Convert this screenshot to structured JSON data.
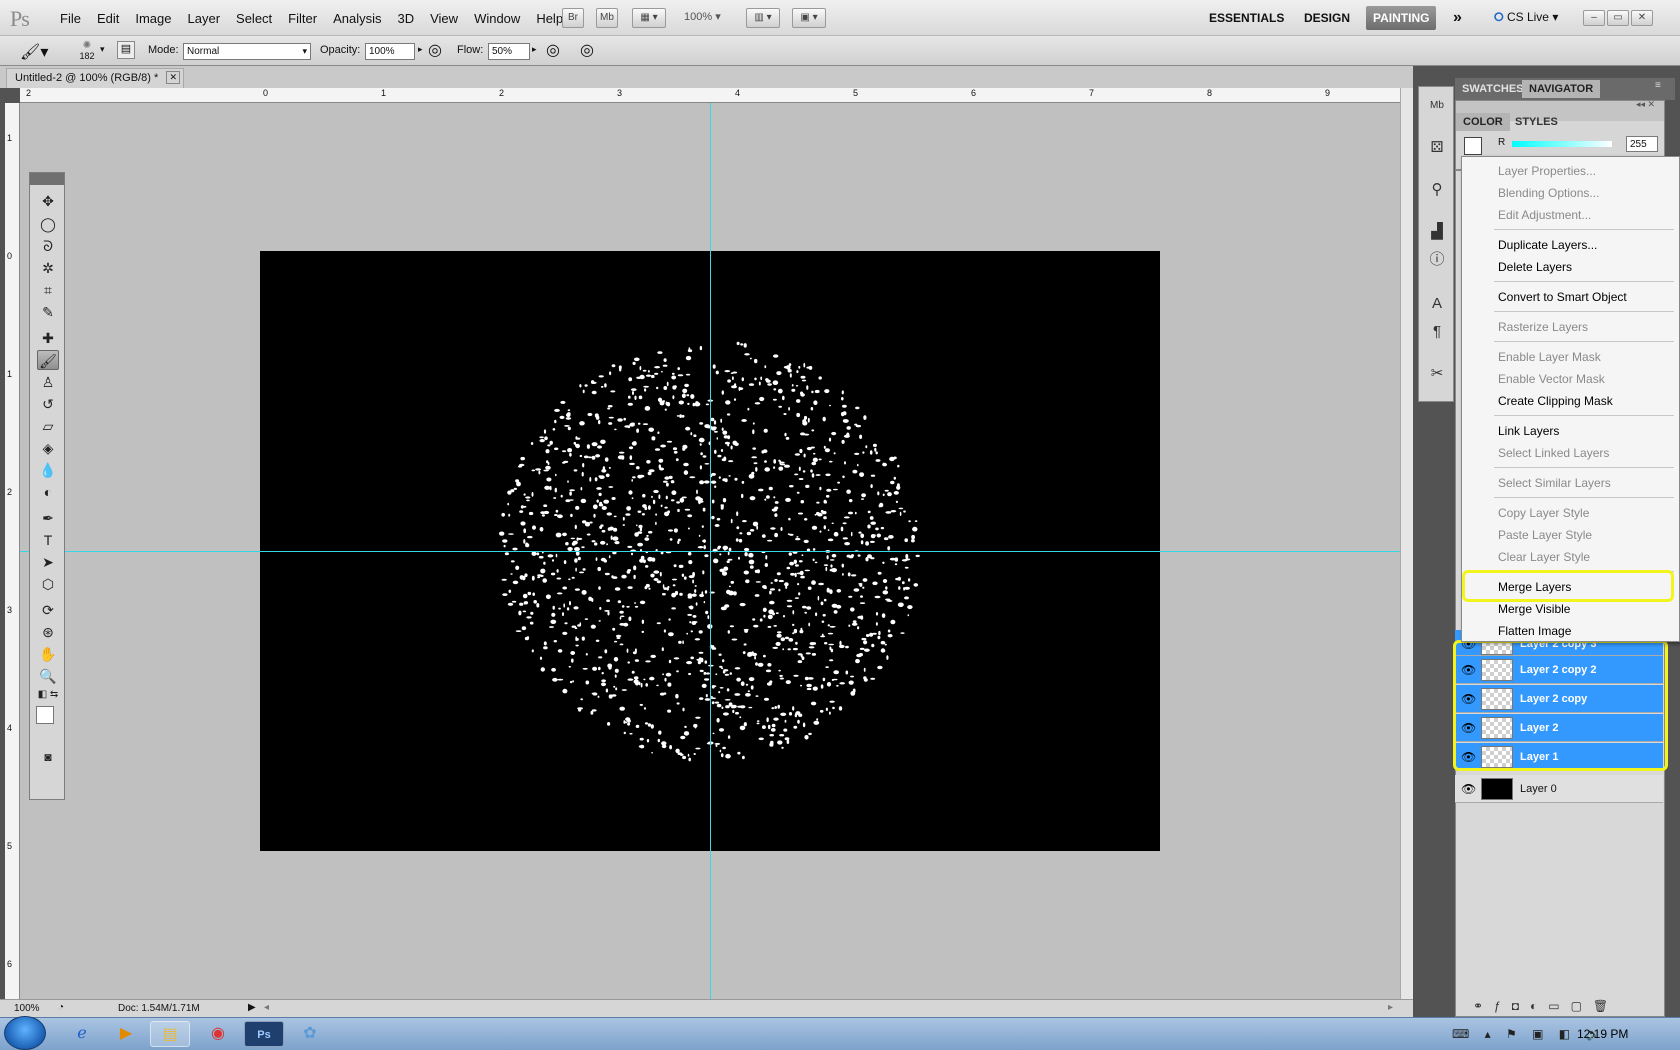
{
  "app": {
    "logo": "Ps"
  },
  "menubar": {
    "items": [
      "File",
      "Edit",
      "Image",
      "Layer",
      "Select",
      "Filter",
      "Analysis",
      "3D",
      "View",
      "Window",
      "Help"
    ],
    "br": "Br",
    "mb": "Mb",
    "zoom": "100%",
    "workspaces": [
      "ESSENTIALS",
      "DESIGN",
      "PAINTING"
    ],
    "more": "»",
    "cslive": "CS Live"
  },
  "options": {
    "brush_size": "182",
    "mode_label": "Mode:",
    "mode_value": "Normal",
    "opacity_label": "Opacity:",
    "opacity_value": "100%",
    "flow_label": "Flow:",
    "flow_value": "50%"
  },
  "document": {
    "tab_title": "Untitled-2 @ 100% (RGB/8) *"
  },
  "ruler": {
    "h_ticks": [
      "2",
      "0",
      "1",
      "2",
      "3",
      "4",
      "5",
      "6",
      "7",
      "8",
      "9"
    ],
    "v_ticks": [
      "1",
      "0",
      "1",
      "2",
      "3",
      "4",
      "5",
      "6"
    ]
  },
  "status": {
    "zoom": "100%",
    "doc": "Doc: 1.54M/1.71M"
  },
  "panels": {
    "tabs1": [
      "SWATCHES",
      "NAVIGATOR"
    ],
    "tabs2": [
      "COLOR",
      "STYLES"
    ],
    "r_label": "R",
    "r_value": "255"
  },
  "context_menu": {
    "items": [
      {
        "label": "Layer Properties...",
        "enabled": false
      },
      {
        "label": "Blending Options...",
        "enabled": false
      },
      {
        "label": "Edit Adjustment...",
        "enabled": false
      },
      {
        "label": "Duplicate Layers...",
        "enabled": true
      },
      {
        "label": "Delete Layers",
        "enabled": true
      },
      {
        "label": "Convert to Smart Object",
        "enabled": true
      },
      {
        "label": "Rasterize Layers",
        "enabled": false
      },
      {
        "label": "Enable Layer Mask",
        "enabled": false
      },
      {
        "label": "Enable Vector Mask",
        "enabled": false
      },
      {
        "label": "Create Clipping Mask",
        "enabled": true
      },
      {
        "label": "Link Layers",
        "enabled": true
      },
      {
        "label": "Select Linked Layers",
        "enabled": false
      },
      {
        "label": "Select Similar Layers",
        "enabled": false
      },
      {
        "label": "Copy Layer Style",
        "enabled": false
      },
      {
        "label": "Paste Layer Style",
        "enabled": false
      },
      {
        "label": "Clear Layer Style",
        "enabled": false
      },
      {
        "label": "Merge Layers",
        "enabled": true
      },
      {
        "label": "Merge Visible",
        "enabled": true
      },
      {
        "label": "Flatten Image",
        "enabled": true
      }
    ]
  },
  "layers": [
    {
      "name": "Layer 2 copy 3",
      "selected": true
    },
    {
      "name": "Layer 2 copy 2",
      "selected": true
    },
    {
      "name": "Layer 2 copy",
      "selected": true
    },
    {
      "name": "Layer 2",
      "selected": true
    },
    {
      "name": "Layer 1",
      "selected": true
    },
    {
      "name": "Layer 0",
      "selected": false
    }
  ],
  "taskbar": {
    "clock": "12:19 PM"
  },
  "colors": {
    "guide": "#36d8e6",
    "selection": "#3399ff",
    "highlight": "#f3f31d"
  }
}
